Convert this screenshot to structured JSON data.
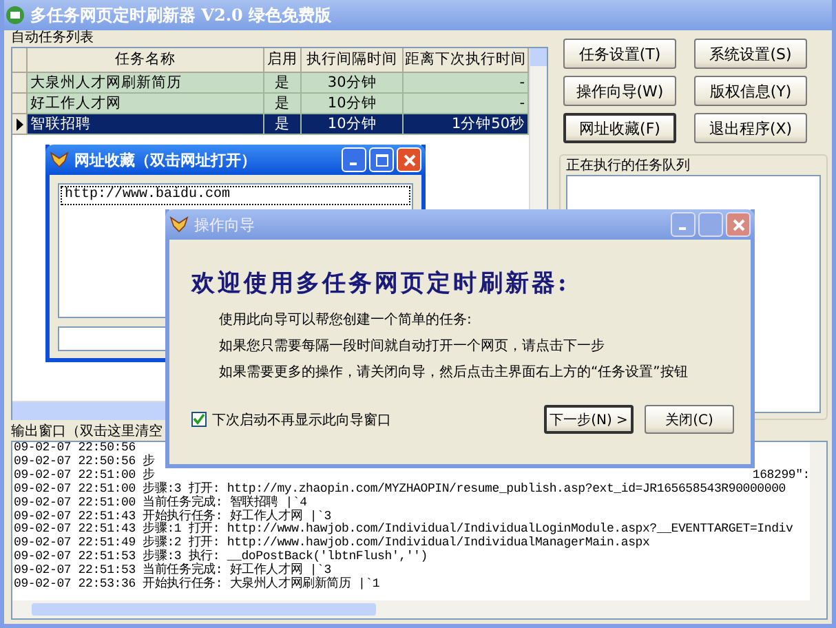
{
  "window": {
    "title": "多任务网页定时刷新器 V2.0 绿色免费版"
  },
  "task_list": {
    "label": "自动任务列表",
    "columns": [
      "任务名称",
      "启用",
      "执行间隔时间",
      "距离下次执行时间"
    ],
    "rows": [
      {
        "name": "大泉州人才网刷新简历",
        "enabled": "是",
        "interval": "30分钟",
        "remaining": "-",
        "selected": false
      },
      {
        "name": "好工作人才网",
        "enabled": "是",
        "interval": "10分钟",
        "remaining": "-",
        "selected": false
      },
      {
        "name": "智联招聘",
        "enabled": "是",
        "interval": "10分钟",
        "remaining": "1分钟50秒",
        "selected": true
      }
    ]
  },
  "buttons": [
    {
      "label": "任务设置(T)",
      "focused": false
    },
    {
      "label": "系统设置(S)",
      "focused": false
    },
    {
      "label": "操作向导(W)",
      "focused": false
    },
    {
      "label": "版权信息(Y)",
      "focused": false
    },
    {
      "label": "网址收藏(F)",
      "focused": true
    },
    {
      "label": "退出程序(X)",
      "focused": false
    }
  ],
  "queue": {
    "label": "正在执行的任务队列"
  },
  "output": {
    "label": "输出窗口（双击这里清空",
    "lines": [
      {
        "text": "09-02-07 22:50:56"
      },
      {
        "text": "09-02-07 22:50:56 步"
      },
      {
        "text": "09-02-07 22:51:00 步",
        "tail": "168299\":"
      },
      {
        "text": "09-02-07 22:51:00 步骤:3 打开: http://my.zhaopin.com/MYZHAOPIN/resume_publish.asp?ext_id=JR165658543R90000000"
      },
      {
        "text": "09-02-07 22:51:00 当前任务完成: 智联招聘 |`4"
      },
      {
        "text": "09-02-07 22:51:43 开始执行任务: 好工作人才网 |`3"
      },
      {
        "text": "09-02-07 22:51:43 步骤:1 打开: http://www.hawjob.com/Individual/IndividualLoginModule.aspx?__EVENTTARGET=Indiv"
      },
      {
        "text": "09-02-07 22:51:49 步骤:2 打开: http://www.hawjob.com/Individual/IndividualManagerMain.aspx"
      },
      {
        "text": "09-02-07 22:51:53 步骤:3 执行: __doPostBack('lbtnFlush','')"
      },
      {
        "text": "09-02-07 22:51:53 当前任务完成: 好工作人才网 |`3"
      },
      {
        "text": "09-02-07 22:53:36 开始执行任务: 大泉州人才网刷新简历 |`1"
      }
    ]
  },
  "bookmarks_window": {
    "title": "网址收藏（双击网址打开）",
    "items": [
      {
        "url": "http://www.baidu.com",
        "selected": true
      }
    ]
  },
  "wizard": {
    "title": "操作向导",
    "heading": "欢迎使用多任务网页定时刷新器:",
    "lines": [
      "使用此向导可以帮您创建一个简单的任务:",
      "如果您只需要每隔一段时间就自动打开一个网页，请点击下一步",
      "如果需要更多的操作，请关闭向导，然后点击主界面右上方的“任务设置”按钮"
    ],
    "checkbox": {
      "label": "下次启动不再显示此向导窗口",
      "checked": true
    },
    "buttons": [
      {
        "label": "下一步(N) >",
        "default": true
      },
      {
        "label": "关闭(C)",
        "default": false
      }
    ]
  }
}
